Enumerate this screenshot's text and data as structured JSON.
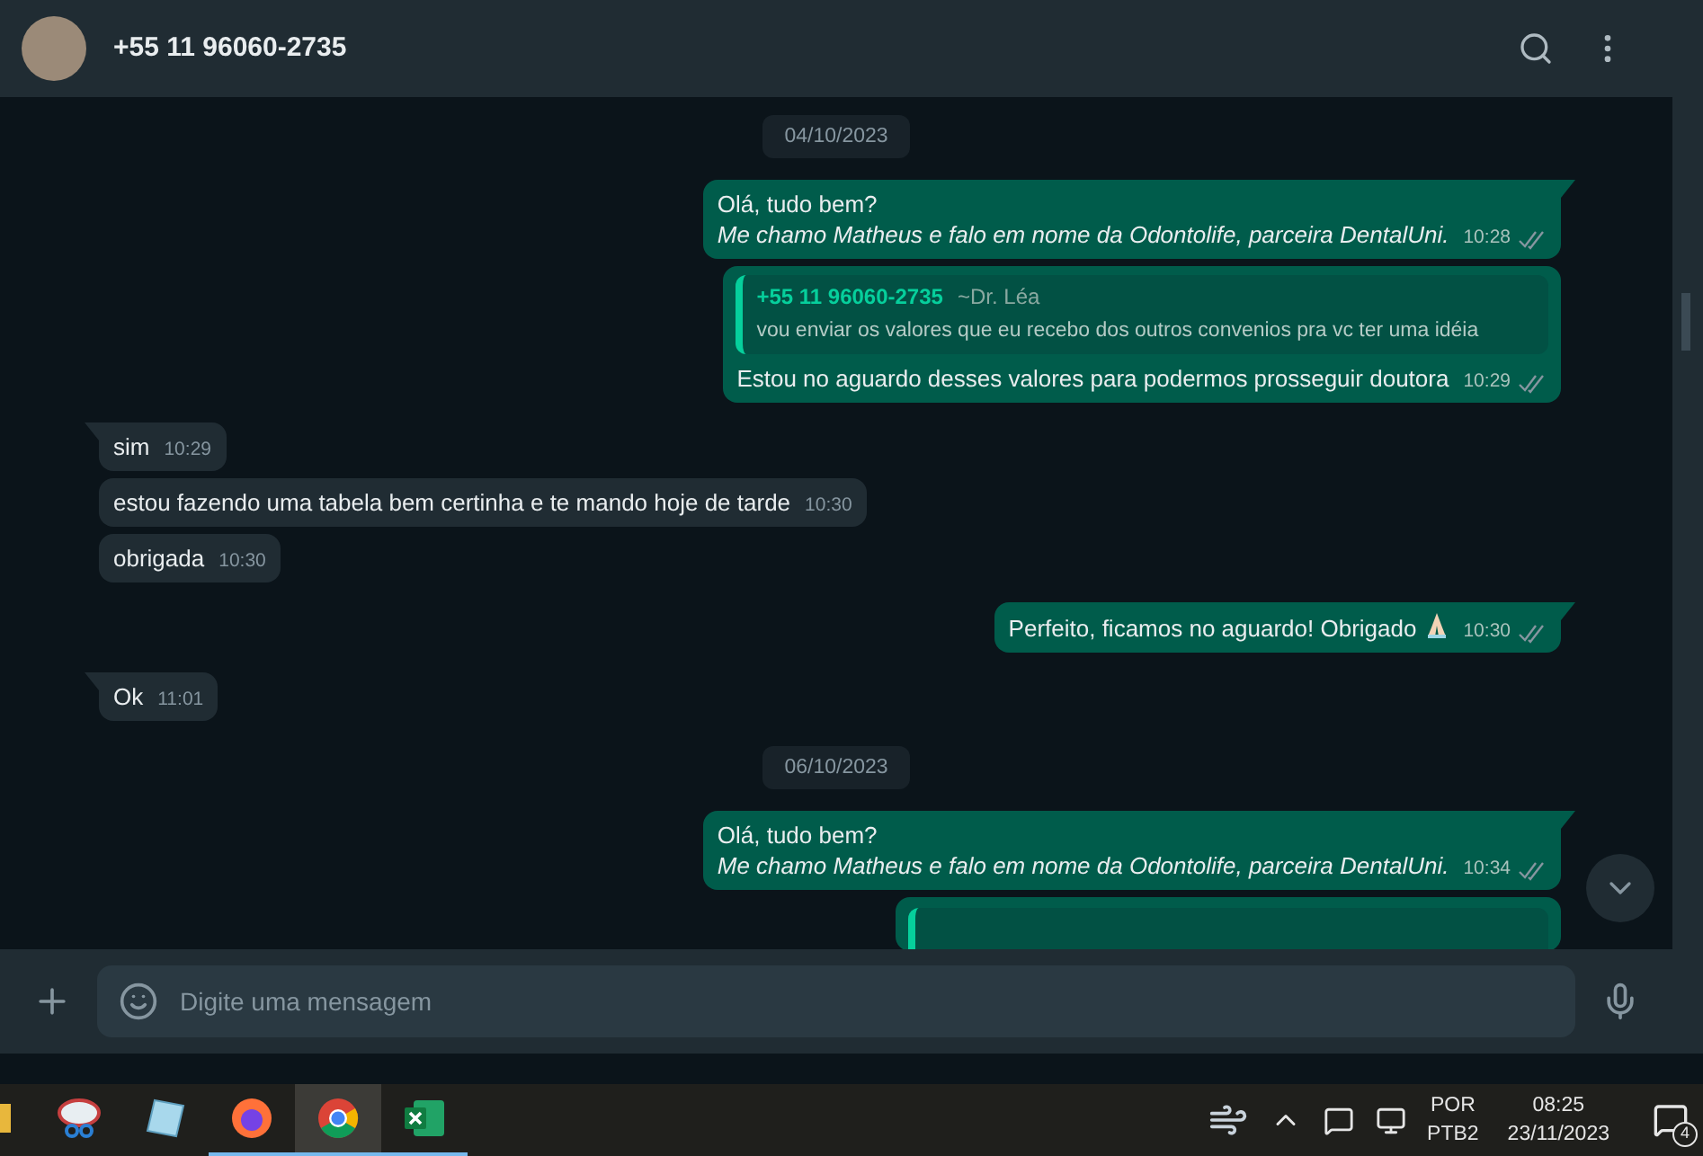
{
  "header": {
    "contact": "+55 11 96060-2735"
  },
  "messages": [
    {
      "kind": "date",
      "text": "04/10/2023"
    },
    {
      "kind": "out",
      "lines": [
        "Olá, tudo bem?",
        "*Me chamo Matheus e falo em nome da Odontolife, parceira DentalUni.*"
      ],
      "time": "10:28",
      "tail": true
    },
    {
      "kind": "out",
      "quote": {
        "author": "+55 11 96060-2735",
        "note": "~Dr. Léa",
        "text": "vou enviar os valores que eu recebo dos outros convenios pra vc ter uma idéia"
      },
      "lines": [
        "Estou no aguardo desses valores para podermos prosseguir doutora"
      ],
      "time": "10:29",
      "tail": false
    },
    {
      "kind": "in",
      "lines": [
        "sim"
      ],
      "time": "10:29",
      "tail": true
    },
    {
      "kind": "in",
      "lines": [
        "estou fazendo uma tabela bem certinha e te mando hoje de tarde"
      ],
      "time": "10:30",
      "tail": false
    },
    {
      "kind": "in",
      "lines": [
        "obrigada"
      ],
      "time": "10:30",
      "tail": false
    },
    {
      "kind": "out",
      "lines": [
        "Perfeito, ficamos no aguardo! Obrigado"
      ],
      "emoji": true,
      "time": "10:30",
      "tail": true
    },
    {
      "kind": "in",
      "lines": [
        "Ok"
      ],
      "time": "11:01",
      "tail": true
    },
    {
      "kind": "date",
      "text": "06/10/2023"
    },
    {
      "kind": "out",
      "lines": [
        "Olá, tudo bem?",
        "*Me chamo Matheus e falo em nome da Odontolife, parceira DentalUni.*"
      ],
      "time": "10:34",
      "tail": true
    },
    {
      "kind": "cut"
    }
  ],
  "composer": {
    "placeholder": "Digite uma mensagem"
  },
  "taskbar": {
    "apps": [
      {
        "kind": "folder",
        "running": false,
        "selected": false
      },
      {
        "kind": "snip",
        "running": false,
        "selected": false
      },
      {
        "kind": "notepad",
        "running": false,
        "selected": false
      },
      {
        "kind": "firefox",
        "running": true,
        "selected": false
      },
      {
        "kind": "chrome",
        "running": true,
        "selected": true
      },
      {
        "kind": "excel",
        "running": true,
        "selected": false
      }
    ],
    "lang": "POR",
    "layout": "PTB2",
    "time": "08:25",
    "date": "23/11/2023",
    "notifications": "4"
  }
}
